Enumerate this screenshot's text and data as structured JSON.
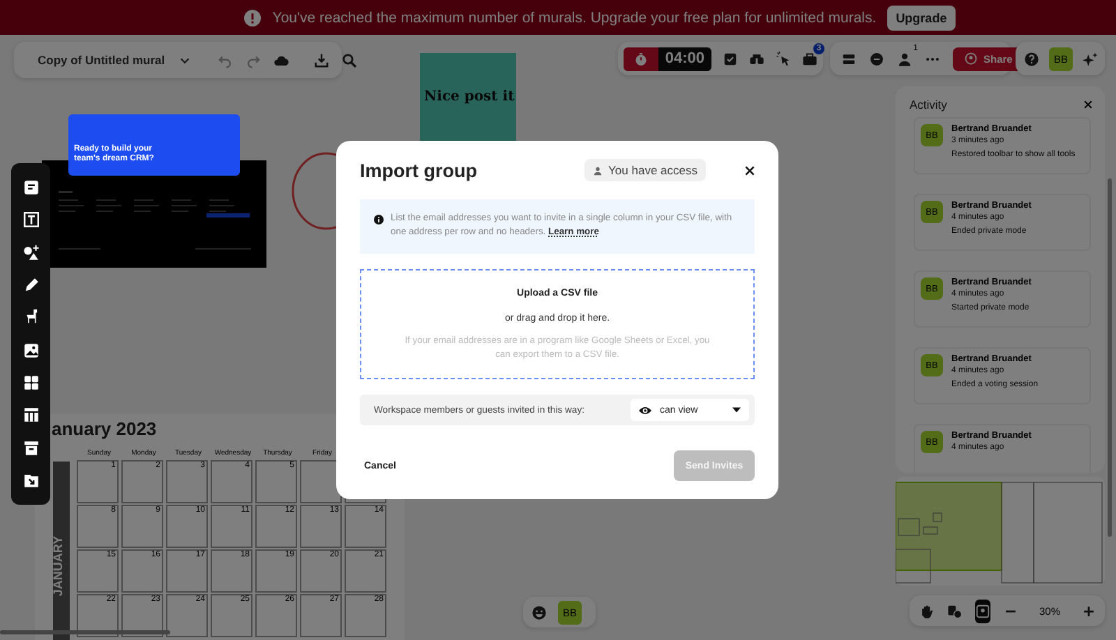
{
  "banner": {
    "message": "You've reached the maximum number of murals. Upgrade your free plan for unlimited murals.",
    "button": "Upgrade"
  },
  "toolbar": {
    "title": "Copy of Untitled mural",
    "timer": "04:00",
    "notification_count": "3",
    "people_count": "1",
    "share": "Share",
    "avatar": "BB"
  },
  "canvas": {
    "sticky_note": "Nice post it",
    "promo_card": "Ready to build your team's dream CRM?",
    "calendar": {
      "title": "anuary 2023",
      "month_label": "JANUARY",
      "weekdays": [
        "Sunday",
        "Monday",
        "Tuesday",
        "Wednesday",
        "Thursday",
        "Friday"
      ],
      "weeks": [
        [
          "1",
          "2",
          "3",
          "4",
          "5"
        ],
        [
          "8",
          "9",
          "10",
          "11",
          "12",
          "13",
          "14"
        ],
        [
          "15",
          "16",
          "17",
          "18",
          "19",
          "20",
          "21"
        ],
        [
          "22",
          "23",
          "24",
          "25",
          "26",
          "27",
          "28"
        ]
      ]
    }
  },
  "activity": {
    "title": "Activity",
    "items": [
      {
        "avatar": "BB",
        "name": "Bertrand Bruandet",
        "time": "3 minutes ago",
        "action": "Restored toolbar to show all tools"
      },
      {
        "avatar": "BB",
        "name": "Bertrand Bruandet",
        "time": "4 minutes ago",
        "action": "Ended private mode"
      },
      {
        "avatar": "BB",
        "name": "Bertrand Bruandet",
        "time": "4 minutes ago",
        "action": "Started private mode"
      },
      {
        "avatar": "BB",
        "name": "Bertrand Bruandet",
        "time": "4 minutes ago",
        "action": "Ended a voting session"
      },
      {
        "avatar": "BB",
        "name": "Bertrand Bruandet",
        "time": "4 minutes ago"
      }
    ]
  },
  "bottom": {
    "avatar": "BB",
    "zoom": "30%"
  },
  "modal": {
    "title": "Import group",
    "access": "You have access",
    "info": "List the email addresses you want to invite in a single column in your CSV file, with one address per row and no headers.",
    "info_link": "Learn more",
    "upload_title": "Upload a CSV file",
    "upload_sub": "or drag and drop it here.",
    "upload_hint": "If your email addresses are in a program like Google Sheets or Excel, you can export them to a CSV file.",
    "permission_label": "Workspace members or guests invited in this way:",
    "permission_value": "can view",
    "cancel": "Cancel",
    "submit": "Send Invites",
    "submit_disabled": true
  }
}
